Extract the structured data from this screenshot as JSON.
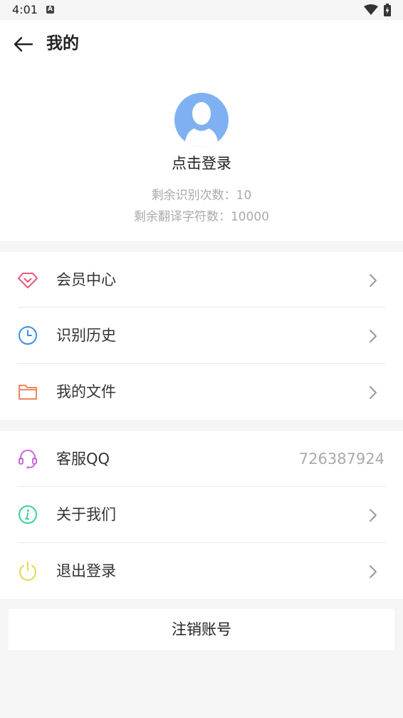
{
  "status_bar": {
    "time": "4:01",
    "notification_icon": "A"
  },
  "header": {
    "title": "我的",
    "back_icon": "arrow-left-icon",
    "login_text": "点击登录",
    "remaining_recognitions": "剩余识别次数：10",
    "remaining_translation_chars": "剩余翻译字符数：10000"
  },
  "menu_group_1": {
    "items": [
      {
        "label": "会员中心",
        "icon": "diamond-icon",
        "color": "#e9577a"
      },
      {
        "label": "识别历史",
        "icon": "clock-icon",
        "color": "#3e8ee8"
      },
      {
        "label": "我的文件",
        "icon": "folder-icon",
        "color": "#f0875e"
      }
    ]
  },
  "menu_group_2": {
    "items": [
      {
        "label": "客服QQ",
        "icon": "headset-icon",
        "color": "#c86bd8",
        "value": "726387924"
      },
      {
        "label": "关于我们",
        "icon": "info-icon",
        "color": "#3fcf9c"
      },
      {
        "label": "退出登录",
        "icon": "power-icon",
        "color": "#e8d94a"
      }
    ]
  },
  "cancel_account_label": "注销账号",
  "colors": {
    "avatar": "#7fb1f2",
    "background": "#f5f5f5"
  }
}
